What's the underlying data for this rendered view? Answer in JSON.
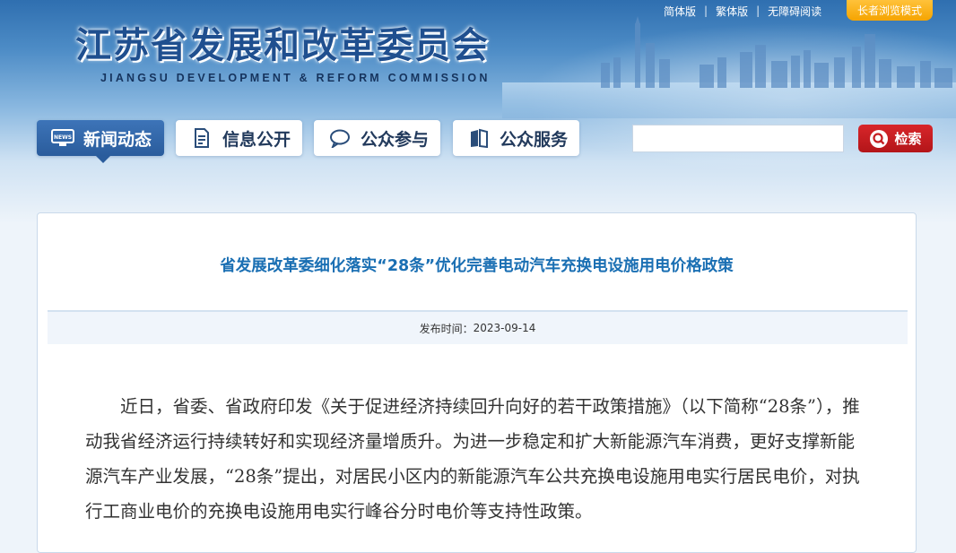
{
  "header": {
    "site_title": "江苏省发展和改革委员会",
    "site_subtitle": "JIANGSU DEVELOPMENT & REFORM COMMISSION",
    "top_links": [
      "简体版",
      "繁体版",
      "无障碍阅读"
    ],
    "elder_mode_label": "长者浏览模式"
  },
  "nav": {
    "items": [
      {
        "label": "新闻动态",
        "icon": "news-icon",
        "active": true
      },
      {
        "label": "信息公开",
        "icon": "document-icon",
        "active": false
      },
      {
        "label": "公众参与",
        "icon": "chat-icon",
        "active": false
      },
      {
        "label": "公众服务",
        "icon": "book-icon",
        "active": false
      }
    ]
  },
  "search": {
    "placeholder": "",
    "button_label": "检索",
    "button_icon": "search-icon"
  },
  "article": {
    "title": "省发展改革委细化落实“28条”优化完善电动汽车充换电设施用电价格政策",
    "publish_label": "发布时间：",
    "publish_date": "2023-09-14",
    "body": "近日，省委、省政府印发《关于促进经济持续回升向好的若干政策措施》（以下简称“28条”），推动我省经济运行持续转好和实现经济量增质升。为进一步稳定和扩大新能源汽车消费，更好支撑新能源汽车产业发展，“28条”提出，对居民小区内的新能源汽车公共充换电设施用电实行居民电价，对执行工商业电价的充换电设施用电实行峰谷分时电价等支持性政策。"
  },
  "colors": {
    "title_blue": "#1a6fb3",
    "nav_active": "#2a5c9c",
    "search_red": "#c41e22",
    "elder_orange": "#f5a400"
  }
}
